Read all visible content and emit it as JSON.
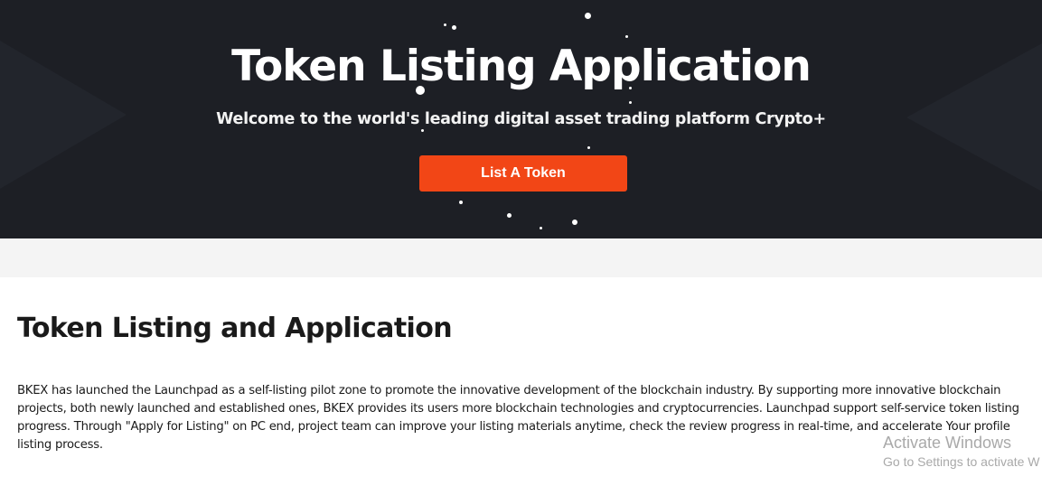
{
  "hero": {
    "title": "Token Listing Application",
    "subtitle": "Welcome to the world's leading digital asset trading platform Crypto+",
    "cta_label": "List A Token"
  },
  "content": {
    "title": "Token Listing and Application",
    "body": "BKEX has launched the Launchpad as a self-listing pilot zone to promote the innovative development of the blockchain industry. By supporting more innovative blockchain projects, both newly launched and established ones, BKEX provides its users more blockchain technologies and cryptocurrencies. Launchpad support self-service token listing progress. Through \"Apply for Listing\" on PC end, project team can improve your listing materials anytime, check the review progress in real-time, and accelerate Your profile listing process."
  },
  "watermark": {
    "title": "Activate Windows",
    "subtitle": "Go to Settings to activate W"
  },
  "colors": {
    "hero_background": "#1d1f25",
    "accent": "#f24616",
    "band": "#f4f4f4",
    "text": "#1a1a1a"
  }
}
